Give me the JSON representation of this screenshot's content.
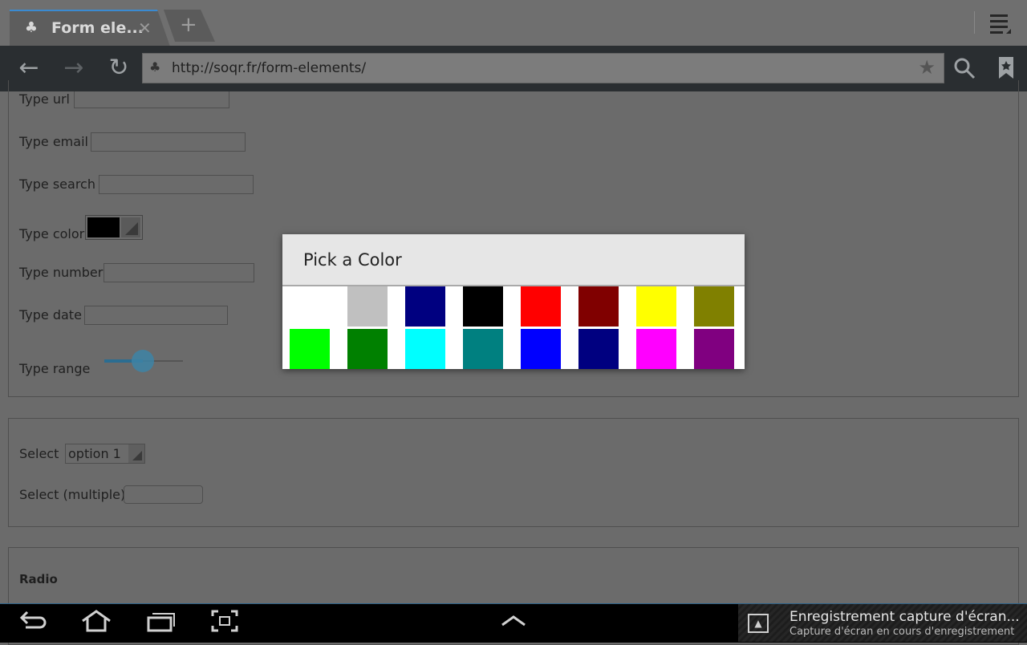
{
  "browser": {
    "tab_title": "Form ele...",
    "new_tab_label": "+",
    "url": "http://soqr.fr/form-elements/"
  },
  "form": {
    "type_url_label": "Type url",
    "type_email_label": "Type email",
    "type_search_label": "Type search",
    "type_color_label": "Type color",
    "type_number_label": "Type number",
    "type_date_label": "Type date",
    "type_range_label": "Type range",
    "color_value": "#000000",
    "range_value_fraction": 0.5,
    "select_label": "Select",
    "select_value": "option 1",
    "select_multiple_label": "Select (multiple)",
    "radio_heading": "Radio"
  },
  "dialog": {
    "title": "Pick a Color",
    "colors": [
      "#ffffff",
      "#c0c0c0",
      "#000080",
      "#000000",
      "#ff0000",
      "#800000",
      "#ffff00",
      "#808000",
      "#00ff00",
      "#008000",
      "#00ffff",
      "#008080",
      "#0000ff",
      "#000080",
      "#ff00ff",
      "#800080"
    ]
  },
  "system": {
    "notification_title": "Enregistrement capture d'écran...",
    "notification_subtitle": "Capture d'écran en cours d'enregistrement"
  },
  "icons": {
    "back": "arrow-left",
    "forward": "arrow-right",
    "reload": "refresh",
    "search": "magnifier",
    "bookmark": "bookmark",
    "menu": "menu"
  }
}
